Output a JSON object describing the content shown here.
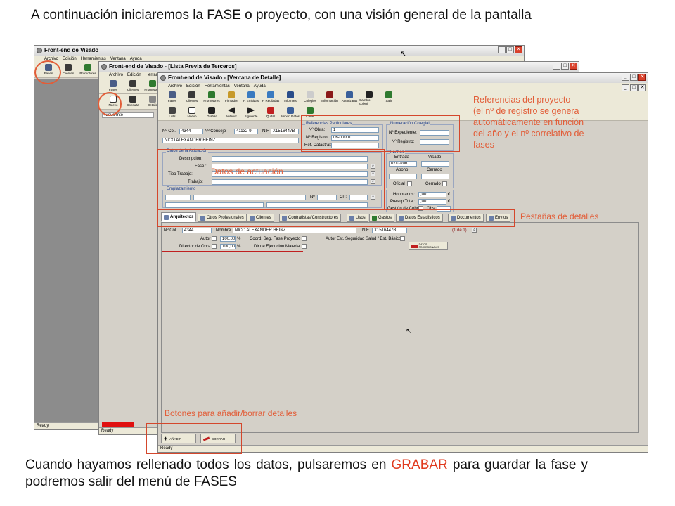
{
  "slide": {
    "intro": "A continuación iniciaremos la FASE o proyecto, con una visión general de la pantalla",
    "outro_part1": "Cuando hayamos rellenado todos los datos, pulsaremos en ",
    "outro_highlight": "GRABAR",
    "outro_part2": " para guardar la fase y podremos salir del menú de FASES"
  },
  "annotations": {
    "referencias_line1": "Referencias del proyecto",
    "referencias_line2": "(el nº de registro se genera",
    "referencias_line3": "automáticamente en función",
    "referencias_line4": "del año y el nº correlativo de",
    "referencias_line5": "fases",
    "datos_actuacion": "Datos de actuación",
    "pestanas": "Pestañas de detalles",
    "botones": "Botones para añadir/borrar detalles"
  },
  "win1": {
    "title": "Front-end de Visado",
    "menu": [
      "Archivo",
      "Edición",
      "Herramientas",
      "Ventana",
      "Ayuda"
    ],
    "tools": [
      "Fases",
      "Clientes",
      "Promotores"
    ],
    "status": "Ready"
  },
  "win2": {
    "title": "Front-end de Visado - [Lista Previa de Terceros]",
    "menu": [
      "Archivo",
      "Edición",
      "Herrami"
    ],
    "tools": [
      "Fases",
      "Clientes",
      "Promotores"
    ],
    "tools2": [
      "Nuevo",
      "Consulta",
      "Detalle"
    ],
    "list_item": "Nuevo Inte",
    "status": "Ready"
  },
  "win3": {
    "title": "Front-end de Visado - [Ventana de Detalle]",
    "menu": [
      "Archivo",
      "Edición",
      "Herramientas",
      "Ventana",
      "Ayuda"
    ],
    "tools": [
      "Fases",
      "Clientes",
      "Promotores",
      "Firmador",
      "F. Emitidas",
      "F. Recibidas",
      "Informes",
      "Colegios",
      "Información",
      "Autorizants",
      "Cambio colegi",
      "Salir"
    ],
    "tools2": [
      "Lists",
      "Nuevo",
      "Grabar",
      "Anterior",
      "Siguiente",
      "Quitar",
      "Import Datos",
      "Cerar"
    ],
    "ncol_label": "Nº Col.",
    "ncol_value": "4344",
    "nconsejo_label": "Nº Consejo",
    "nconsejo_value": "41132-9",
    "nif_label": "NIF",
    "nif_value": "X1516447B",
    "name_value": "NICO ALEXANDER HEINZ",
    "ref_part_title": "Referencias Particulares",
    "nobra_label": "Nº Obra:",
    "nobra_value": "1",
    "nregistro_label": "Nº Registro:",
    "nregistro_value": "06-00001",
    "refcat_label": "Ref. Catastral:",
    "numcol_title": "Numeración Colegial",
    "nexp_label": "Nº Expediente:",
    "nreg2_label": "Nº Registro:",
    "fechas_title": "Fechas",
    "entrada_label": "Entrada",
    "visado_label": "Visado",
    "entrada_value": "07/02/06",
    "abono_label": "Abono",
    "cerrado_label": "Cerrado",
    "oficial_label": "Oficial",
    "cerrado2_label": "Cerrado",
    "datos_title": "Datos de la Actuación",
    "descripcion_label": "Descripción:",
    "fase_label": "Fase :",
    "tipo_label": "Tipo Trabajo:",
    "trabajo_label": "Trabajo:",
    "emplaz_title": "Emplazamiento",
    "num_label": "Nº",
    "cp_label": "CP:",
    "honorarios_label": "Honorarios:",
    "honorarios_value": ",00",
    "presup_label": "Presup.Total:",
    "presup_value": ",00",
    "euro": "€",
    "gestion_label": "Gestión de Cobro",
    "obs_label": "Obs:",
    "tabs": [
      "Arquitectos",
      "Otros Profesionales",
      "Clientes",
      "Contratistas/Constructores",
      "Usos",
      "Gastos",
      "Datos Estadísticos",
      "Documentos",
      "Envíos"
    ],
    "d_ncol_label": "Nº Col",
    "d_ncol_value": "4344",
    "d_nombre_label": "Nombre",
    "d_nombre_value": "NICO ALEXANDER HEINZ",
    "d_nif_label": "NIF",
    "d_nif_value": "X1516447B",
    "d_count": "(1 de 1)",
    "autor_label": "Autor",
    "autor_value": "100,00",
    "director_label": "Director de Obra",
    "director_value": "100,00",
    "pct": "%",
    "coord_label": "Coord. Seg. Fase Proyecto",
    "dir_ej_label": "Dir.de Ejecución Material",
    "autor_est_label": "Autor Est. Seguridad Salud / Est. Básico",
    "datos_prof_btn": "DATOS PROFESIONALES",
    "add_btn": "AÑADIR",
    "del_btn": "BORRAR",
    "status": "Ready"
  },
  "colors": {
    "accent": "#e25d38",
    "chrome": "#d4d0c8",
    "field_border": "#7f9db9"
  }
}
